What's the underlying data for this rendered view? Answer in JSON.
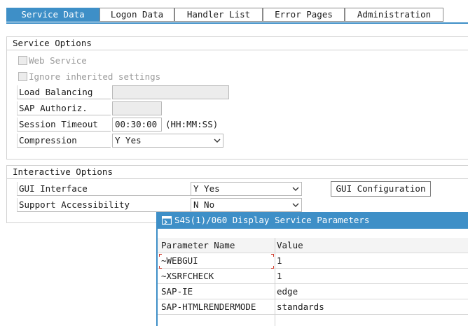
{
  "tabs": [
    "Service Data",
    "Logon Data",
    "Handler List",
    "Error Pages",
    "Administration"
  ],
  "service_options": {
    "title": "Service Options",
    "web_service_label": "Web Service",
    "ignore_inherited_label": "Ignore inherited settings",
    "load_balancing_label": "Load Balancing",
    "load_balancing_value": "",
    "sap_authoriz_label": "SAP Authoriz.",
    "sap_authoriz_value": "",
    "session_timeout_label": "Session Timeout",
    "session_timeout_value": "00:30:00",
    "session_timeout_format": "(HH:MM:SS)",
    "compression_label": "Compression",
    "compression_value": "Y Yes"
  },
  "interactive_options": {
    "title": "Interactive Options",
    "gui_interface_label": "GUI Interface",
    "gui_interface_value": "Y Yes",
    "gui_config_button": "GUI Configuration",
    "support_accessibility_label": "Support Accessibility",
    "support_accessibility_value": "N No"
  },
  "popup": {
    "title": "S4S(1)/060 Display Service Parameters",
    "columns": [
      "Parameter Name",
      "Value"
    ],
    "rows": [
      [
        "~WEBGUI",
        "1"
      ],
      [
        "~XSRFCHECK",
        "1"
      ],
      [
        "SAP-IE",
        "edge"
      ],
      [
        "SAP-HTMLRENDERMODE",
        "standards"
      ]
    ]
  },
  "colors": {
    "accent": "#3e8fc7",
    "mark": "#d23a2a"
  }
}
